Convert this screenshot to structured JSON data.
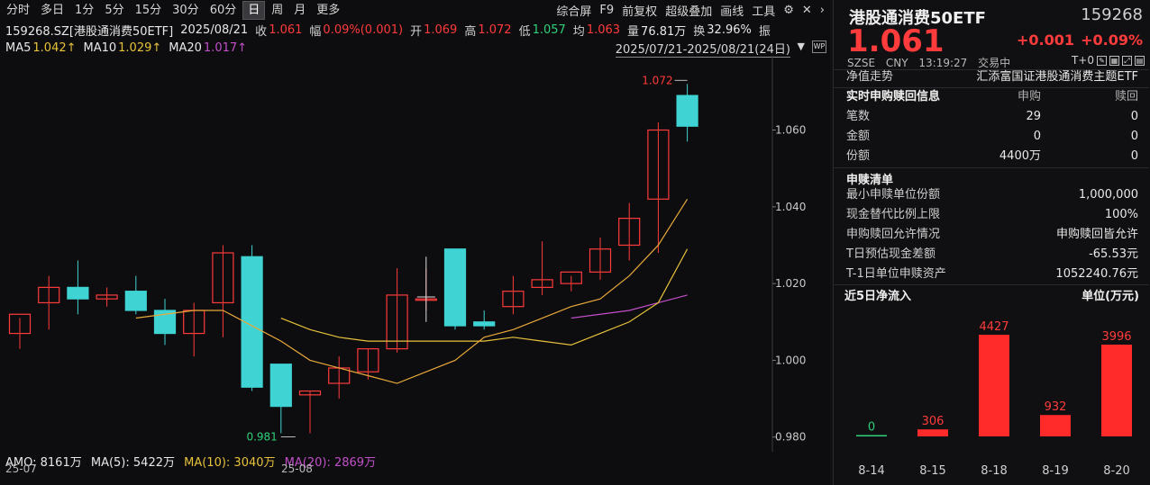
{
  "toolbar": {
    "periods": [
      "分时",
      "多日",
      "1分",
      "5分",
      "15分",
      "30分",
      "60分",
      "日",
      "周",
      "月",
      "更多"
    ],
    "active_period": "日",
    "tools": [
      "综合屏",
      "F9",
      "前复权",
      "超级叠加",
      "画线",
      "工具"
    ]
  },
  "info": {
    "symbol": "159268.SZ[港股通消费50ETF]",
    "date": "2025/08/21",
    "close_label": "收",
    "close": "1.061",
    "range_label": "幅",
    "range": "0.09%(0.001)",
    "open_label": "开",
    "open": "1.069",
    "high_label": "高",
    "high": "1.072",
    "low_label": "低",
    "low": "1.057",
    "avg_label": "均",
    "avg": "1.063",
    "vol_label": "量",
    "vol": "76.81万",
    "turn_label": "换",
    "turn": "32.96%",
    "amp_label": "振"
  },
  "ma": {
    "ma5_label": "MA5",
    "ma5": "1.042↑",
    "ma10_label": "MA10",
    "ma10": "1.029↑",
    "ma20_label": "MA20",
    "ma20": "1.017↑",
    "range_text": "2025/07/21-2025/08/21(24日)"
  },
  "amo": {
    "amo_text": "AMO: 8161万",
    "ma5_text": "MA(5): 5422万",
    "ma10_text": "MA(10): 3040万",
    "ma20_text": "MA(20): 2869万"
  },
  "date_axis": [
    "25-07",
    "25-08"
  ],
  "colors": {
    "up": "#ff3b3b",
    "down": "#3fd3d3",
    "ma5": "#e6e6e6",
    "ma10": "#e7c23a",
    "ma20": "#c24fc9",
    "green": "#2fd07a"
  },
  "chart_data": {
    "type": "candlestick",
    "y_ticks": [
      0.98,
      1.0,
      1.02,
      1.04,
      1.06
    ],
    "y_tick_labels": [
      "0.980",
      "1.000",
      "1.020",
      "1.040",
      "1.060"
    ],
    "ylim": [
      0.979,
      1.077
    ],
    "candles": [
      {
        "o": 1.007,
        "h": 1.011,
        "l": 1.003,
        "c": 1.012
      },
      {
        "o": 1.015,
        "h": 1.022,
        "l": 1.008,
        "c": 1.019
      },
      {
        "o": 1.019,
        "h": 1.026,
        "l": 1.012,
        "c": 1.016
      },
      {
        "o": 1.016,
        "h": 1.019,
        "l": 1.014,
        "c": 1.017
      },
      {
        "o": 1.018,
        "h": 1.022,
        "l": 1.012,
        "c": 1.013
      },
      {
        "o": 1.013,
        "h": 1.016,
        "l": 1.004,
        "c": 1.007
      },
      {
        "o": 1.007,
        "h": 1.015,
        "l": 1.001,
        "c": 1.013
      },
      {
        "o": 1.015,
        "h": 1.03,
        "l": 1.006,
        "c": 1.028
      },
      {
        "o": 1.027,
        "h": 1.03,
        "l": 0.992,
        "c": 0.993
      },
      {
        "o": 0.999,
        "h": 0.999,
        "l": 0.981,
        "c": 0.988
      },
      {
        "o": 0.991,
        "h": 0.992,
        "l": 0.981,
        "c": 0.992
      },
      {
        "o": 0.994,
        "h": 1.001,
        "l": 0.99,
        "c": 0.998
      },
      {
        "o": 0.997,
        "h": 1.003,
        "l": 0.995,
        "c": 1.003
      },
      {
        "o": 1.003,
        "h": 1.024,
        "l": 1.002,
        "c": 1.017
      },
      {
        "o": 1.016,
        "h": 1.024,
        "l": 1.013,
        "c": 1.016
      },
      {
        "o": 1.029,
        "h": 1.029,
        "l": 1.008,
        "c": 1.009
      },
      {
        "o": 1.01,
        "h": 1.013,
        "l": 1.008,
        "c": 1.009
      },
      {
        "o": 1.014,
        "h": 1.022,
        "l": 1.012,
        "c": 1.018
      },
      {
        "o": 1.019,
        "h": 1.031,
        "l": 1.017,
        "c": 1.021
      },
      {
        "o": 1.02,
        "h": 1.022,
        "l": 1.018,
        "c": 1.023
      },
      {
        "o": 1.023,
        "h": 1.032,
        "l": 1.021,
        "c": 1.029
      },
      {
        "o": 1.03,
        "h": 1.041,
        "l": 1.026,
        "c": 1.037
      },
      {
        "o": 1.042,
        "h": 1.062,
        "l": 1.028,
        "c": 1.06
      },
      {
        "o": 1.069,
        "h": 1.072,
        "l": 1.057,
        "c": 1.061
      }
    ],
    "max_label": "1.072",
    "min_label": "0.981",
    "ma5_line": [
      null,
      null,
      null,
      null,
      1.011,
      1.012,
      1.013,
      1.013,
      1.009,
      1.005,
      1.0,
      0.998,
      0.996,
      0.994,
      0.997,
      1.0,
      1.006,
      1.008,
      1.011,
      1.014,
      1.016,
      1.022,
      1.03,
      1.042
    ],
    "ma10_line": [
      null,
      null,
      null,
      null,
      null,
      null,
      null,
      null,
      null,
      1.011,
      1.008,
      1.006,
      1.005,
      1.005,
      1.005,
      1.005,
      1.005,
      1.006,
      1.005,
      1.004,
      1.007,
      1.01,
      1.015,
      1.029
    ],
    "ma20_line": [
      null,
      null,
      null,
      null,
      null,
      null,
      null,
      null,
      null,
      null,
      null,
      null,
      null,
      null,
      null,
      null,
      null,
      null,
      null,
      1.011,
      1.012,
      1.013,
      1.015,
      1.017
    ]
  },
  "quote": {
    "name": "港股通消费50ETF",
    "code": "159268",
    "price": "1.061",
    "change": "+0.001",
    "pct": "+0.09%",
    "exchange": "SZSE",
    "currency": "CNY",
    "time": "13:19:27",
    "status": "交易中",
    "t0": "T+0"
  },
  "nav": {
    "label": "净值走势",
    "fund": "汇添富国证港股通消费主题ETF"
  },
  "subscribe": {
    "title": "实时申购赎回信息",
    "col_sub": "申购",
    "col_red": "赎回",
    "rows": [
      {
        "label": "笔数",
        "sub": "29",
        "red": "0"
      },
      {
        "label": "金额",
        "sub": "0",
        "red": "0"
      },
      {
        "label": "份额",
        "sub": "4400万",
        "red": "0"
      }
    ]
  },
  "listing": {
    "title": "申赎清单",
    "rows": [
      {
        "label": "最小申赎单位份额",
        "value": "1,000,000"
      },
      {
        "label": "现金替代比例上限",
        "value": "100%"
      },
      {
        "label": "申购赎回允许情况",
        "value": "申购赎回皆允许"
      },
      {
        "label": "T日预估现金差额",
        "value": "-65.53元"
      },
      {
        "label": "T-1日单位申赎资产",
        "value": "1052240.76元"
      }
    ]
  },
  "flow": {
    "title": "近5日净流入",
    "unit": "单位(万元)",
    "chart_data": {
      "type": "bar",
      "categories": [
        "8-14",
        "8-15",
        "8-18",
        "8-19",
        "8-20"
      ],
      "values": [
        0,
        306,
        4427,
        932,
        3996
      ],
      "ylim": [
        0,
        4427
      ]
    }
  }
}
